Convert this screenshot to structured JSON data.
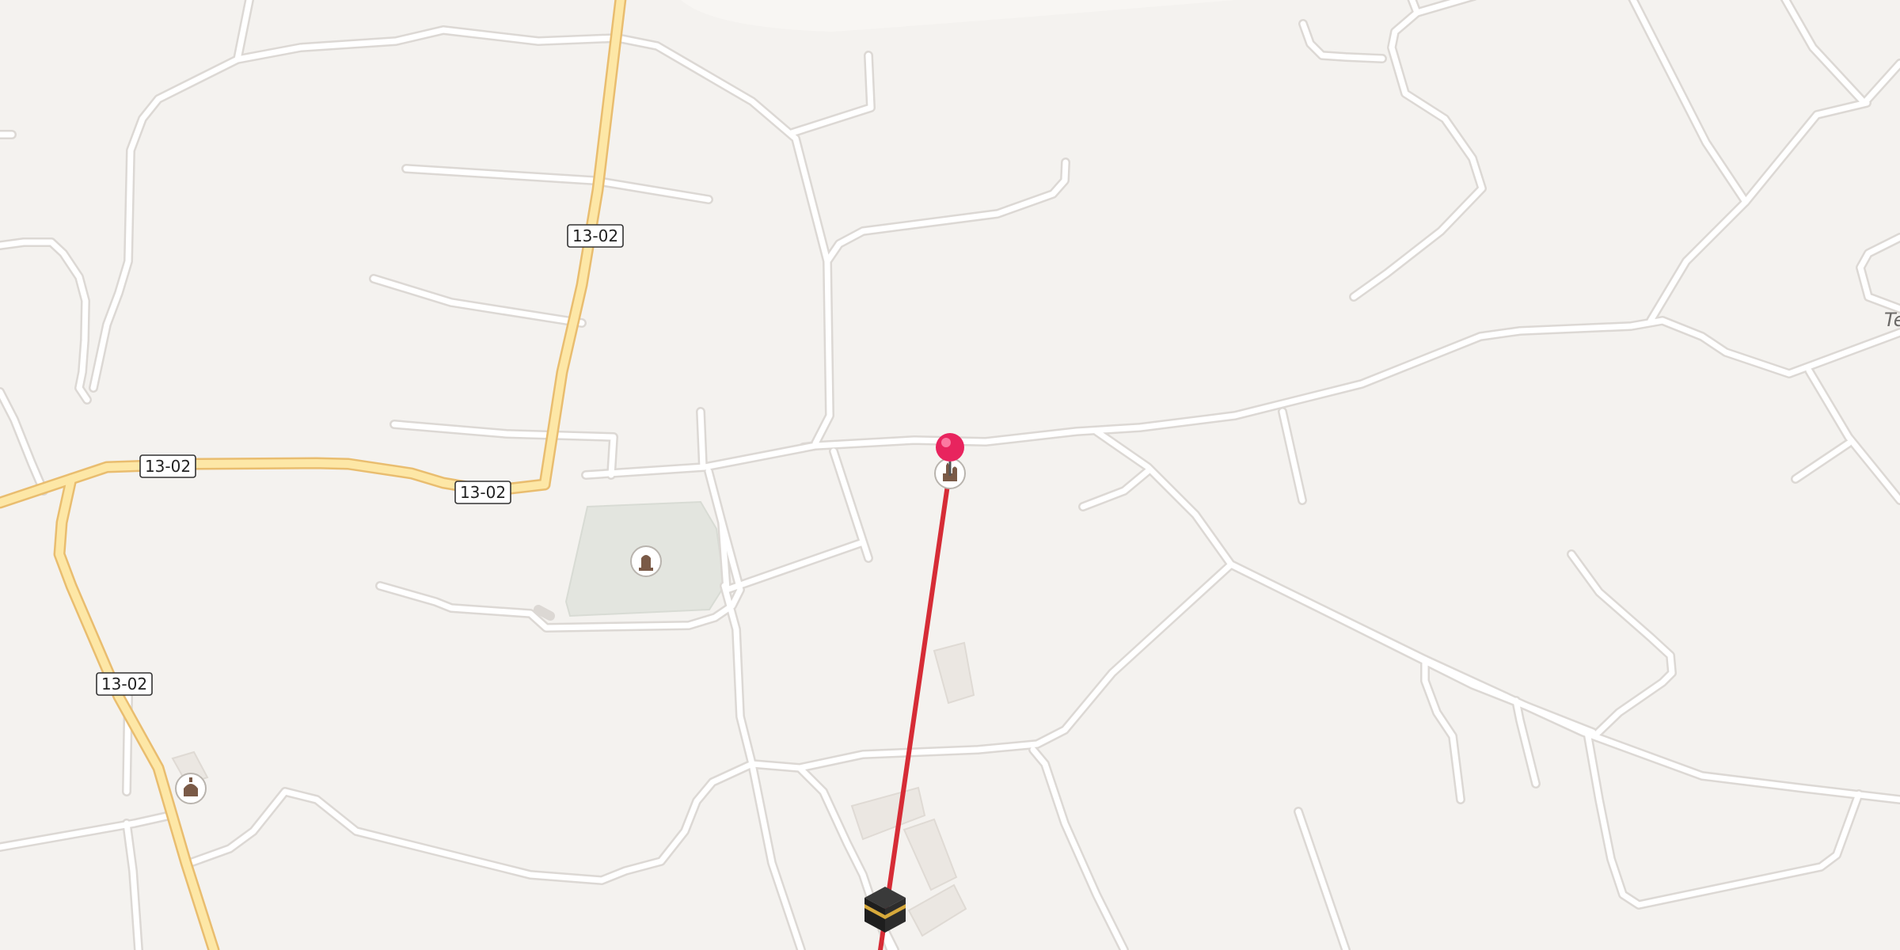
{
  "map": {
    "colors": {
      "background": "#f4f2ef",
      "road": "#ffffff",
      "road_casing": "#dcd8d4",
      "highway": "#fde7a6",
      "highway_casing": "#e9bd6f",
      "cemetery": "#e2e5df",
      "route_line": "#d62c36",
      "pin": "#e8245e"
    },
    "route_shields": [
      {
        "id": "shield-1",
        "label": "13-02"
      },
      {
        "id": "shield-2",
        "label": "13-02"
      },
      {
        "id": "shield-3",
        "label": "13-02"
      },
      {
        "id": "shield-4",
        "label": "13-02"
      }
    ],
    "edge_label": "Te",
    "icons": {
      "pin": "location-pin-icon",
      "mosque_near_pin": "mosque-icon",
      "cemetery": "cemetery-icon",
      "mosque_west": "mosque-icon",
      "kaaba": "kaaba-icon"
    }
  }
}
